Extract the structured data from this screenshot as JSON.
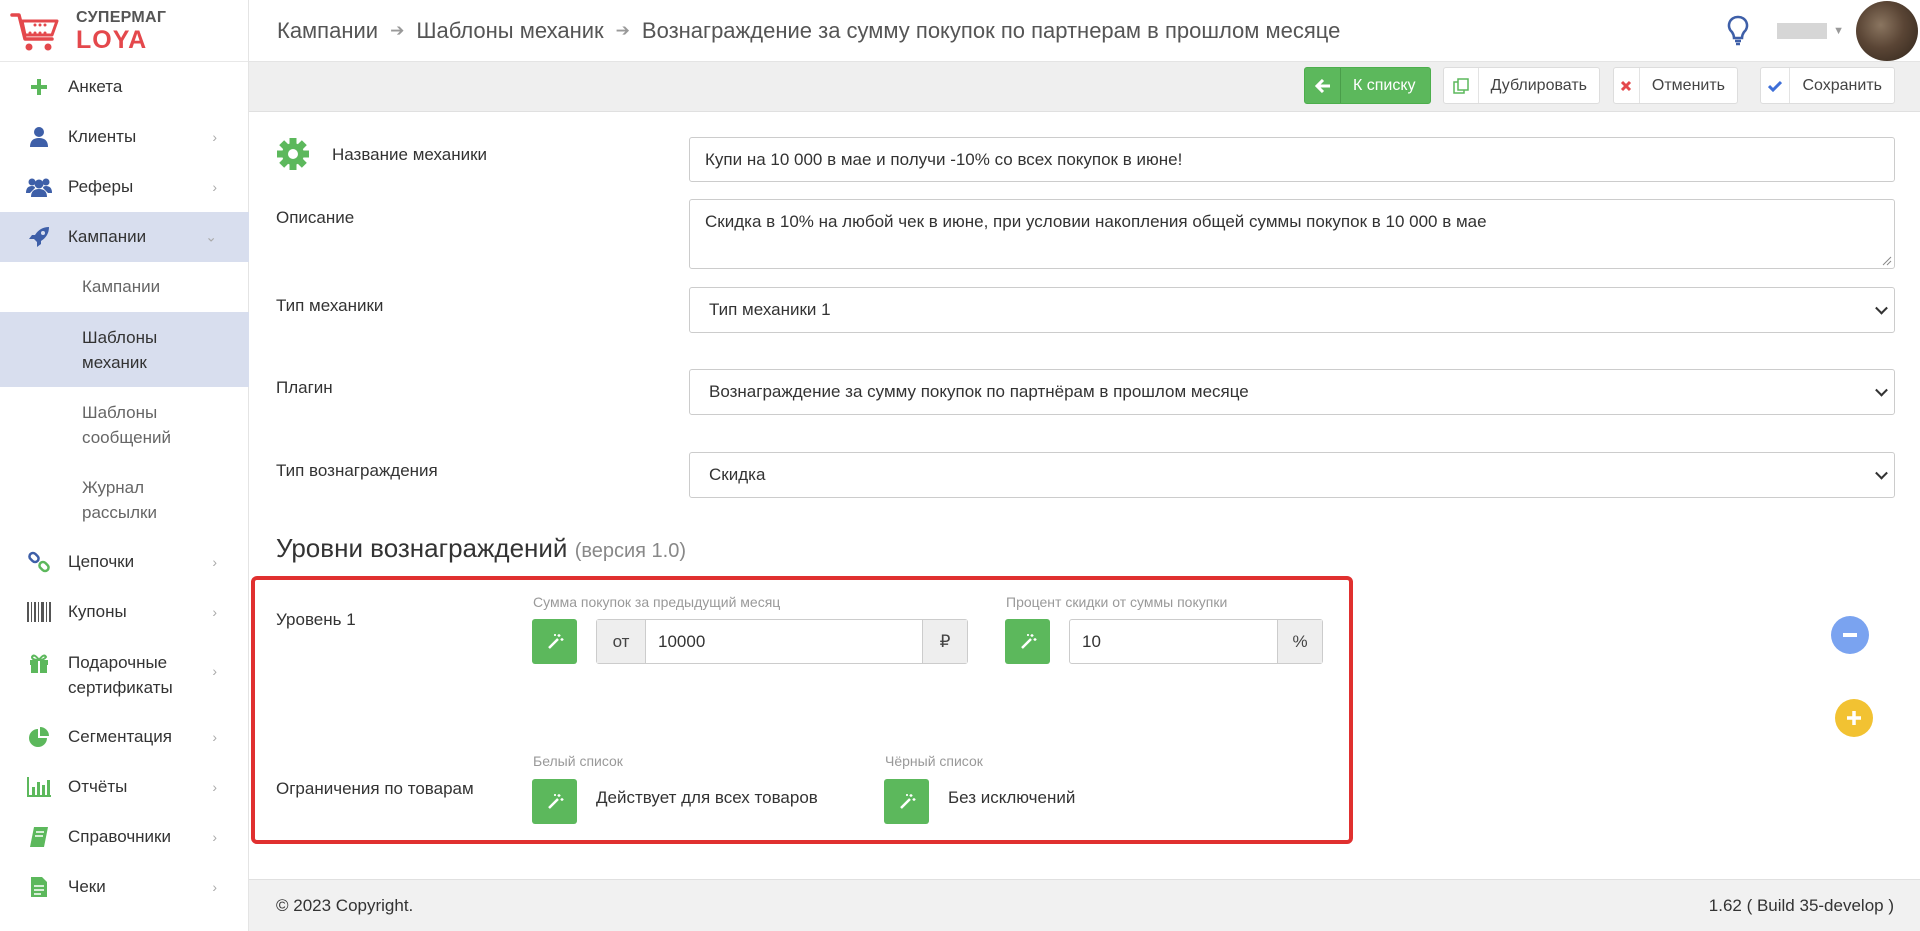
{
  "logo": {
    "top": "СУПЕРМАГ",
    "bottom": "LOYA"
  },
  "breadcrumb": [
    "Кампании",
    "Шаблоны механик",
    "Вознаграждение за сумму покупок по партнерам в прошлом месяце"
  ],
  "sidebar": {
    "items": [
      {
        "label": "Анкета"
      },
      {
        "label": "Клиенты"
      },
      {
        "label": "Реферы"
      },
      {
        "label": "Кампании"
      },
      {
        "label": "Цепочки"
      },
      {
        "label": "Купоны"
      },
      {
        "label": "Подарочные сертификаты"
      },
      {
        "label": "Сегментация"
      },
      {
        "label": "Отчёты"
      },
      {
        "label": "Справочники"
      },
      {
        "label": "Чеки"
      }
    ],
    "subitems": [
      {
        "label": "Кампании"
      },
      {
        "label": "Шаблоны механик"
      },
      {
        "label": "Шаблоны сообщений"
      },
      {
        "label": "Журнал рассылки"
      }
    ]
  },
  "toolbar": {
    "back": "К списку",
    "duplicate": "Дублировать",
    "cancel": "Отменить",
    "save": "Сохранить"
  },
  "form": {
    "name_label": "Название механики",
    "name_value": "Купи на 10 000 в мае и получи -10% со всех покупок в июне!",
    "desc_label": "Описание",
    "desc_value": "Скидка в 10% на любой чек в июне, при условии накопления общей суммы покупок в 10 000 в мае",
    "type_label": "Тип механики",
    "type_value": "Тип механики 1",
    "plugin_label": "Плагин",
    "plugin_value": "Вознаграждение за сумму покупок по партнёрам в прошлом месяце",
    "reward_label": "Тип вознаграждения",
    "reward_value": "Скидка"
  },
  "levels": {
    "title": "Уровни вознаграждений",
    "version": "(версия 1.0)",
    "level_label": "Уровень 1",
    "sum_label": "Сумма покупок за предыдущий месяц",
    "sum_prefix": "от",
    "sum_value": "10000",
    "sum_suffix": "₽",
    "percent_label": "Процент скидки от суммы покупки",
    "percent_value": "10",
    "percent_suffix": "%",
    "restrictions_label": "Ограничения по товарам",
    "white_label": "Белый список",
    "white_value": "Действует для всех товаров",
    "black_label": "Чёрный список",
    "black_value": "Без исключений"
  },
  "footer": {
    "copyright": "© 2023 Copyright.",
    "version": "1.62 ( Build 35-develop )"
  },
  "colors": {
    "green": "#5cb85c",
    "brand_red": "#e4484c",
    "highlight": "#e0302f",
    "active_bg": "#d8deee",
    "minus_btn": "#7aa3f0",
    "plus_btn": "#f2c232"
  }
}
